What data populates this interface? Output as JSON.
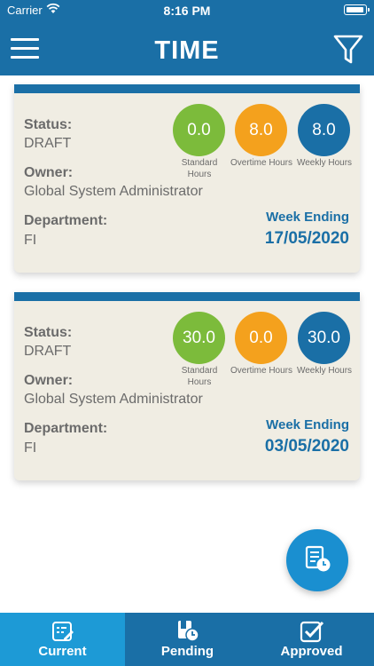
{
  "statusbar": {
    "carrier": "Carrier",
    "time": "8:16 PM"
  },
  "header": {
    "title": "TIME"
  },
  "labels": {
    "status": "Status:",
    "owner": "Owner:",
    "department": "Department:",
    "standard": "Standard Hours",
    "overtime": "Overtime Hours",
    "weekly": "Weekly Hours",
    "week_ending": "Week Ending"
  },
  "timesheets": [
    {
      "status": "DRAFT",
      "owner": "Global System Administrator",
      "department": "FI",
      "standard_hours": "0.0",
      "overtime_hours": "8.0",
      "weekly_hours": "8.0",
      "week_ending": "17/05/2020"
    },
    {
      "status": "DRAFT",
      "owner": "Global System Administrator",
      "department": "FI",
      "standard_hours": "30.0",
      "overtime_hours": "0.0",
      "weekly_hours": "30.0",
      "week_ending": "03/05/2020"
    }
  ],
  "tabs": [
    {
      "label": "Current",
      "active": true
    },
    {
      "label": "Pending",
      "active": false
    },
    {
      "label": "Approved",
      "active": false
    }
  ],
  "colors": {
    "primary": "#1a6fa6",
    "active_tab": "#1d9ad6",
    "card_bg": "#f0ede3",
    "green": "#7cbb3b",
    "orange": "#f4a11d",
    "fab": "#1a8fd0"
  },
  "icons": {
    "menu": "hamburger-menu-icon",
    "filter": "filter-icon",
    "fab": "new-timesheet-icon",
    "current": "edit-list-icon",
    "pending": "clock-document-icon",
    "approved": "checkbox-icon"
  }
}
